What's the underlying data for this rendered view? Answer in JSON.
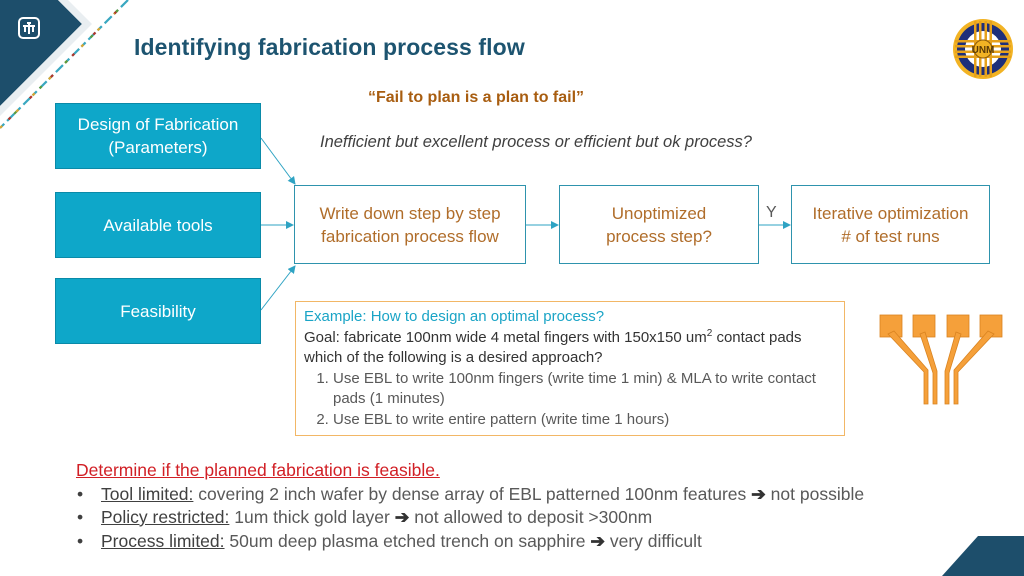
{
  "header": {
    "title": "Identifying fabrication process flow",
    "left_logo_icon": "thunderbird-logo-icon",
    "right_logo_icon": "university-seal-icon"
  },
  "quote": "“Fail to plan is a plan to fail”",
  "question": "Inefficient but excellent process or efficient but ok process?",
  "inputs": [
    {
      "line1": "Design of Fabrication",
      "line2": "(Parameters)"
    },
    {
      "line1": "Available tools",
      "line2": ""
    },
    {
      "line1": "Feasibility",
      "line2": ""
    }
  ],
  "flow": [
    {
      "line1": "Write down step by step",
      "line2": "fabrication process flow"
    },
    {
      "line1": "Unoptimized",
      "line2": "process step?"
    },
    {
      "line1": "Iterative optimization",
      "line2": "# of test runs"
    }
  ],
  "decision_label": "Y",
  "example": {
    "title": "Example: How to design an optimal process?",
    "goal_prefix": "Goal: fabricate 100nm wide 4 metal fingers with 150x150 um",
    "goal_sup": "2",
    "goal_suffix": " contact pads which of the following is a desired approach?",
    "options": [
      "Use EBL to write 100nm fingers (write time 1 min) & MLA to write contact pads (1 minutes)",
      "Use EBL to write entire pattern (write time 1 hours)"
    ]
  },
  "feasibility": {
    "heading": "Determine if the planned fabrication is feasible.",
    "items": [
      {
        "label": "Tool limited:",
        "text": " covering 2 inch wafer by dense array of EBL patterned 100nm features ",
        "arrow": "➔",
        "result": " not possible"
      },
      {
        "label": "Policy restricted:",
        "text": " 1um thick gold layer ",
        "arrow": "➔",
        "result": " not allowed to deposit >300nm"
      },
      {
        "label": "Process limited:",
        "text": " 50um deep plasma etched trench on sapphire ",
        "arrow": "➔",
        "result": " very difficult"
      }
    ]
  },
  "colors": {
    "title": "#1d5470",
    "accent_teal": "#0ea7c9",
    "quote_orange": "#a85d10",
    "heading_red": "#d11f25",
    "finger_orange": "#f5a03a"
  }
}
